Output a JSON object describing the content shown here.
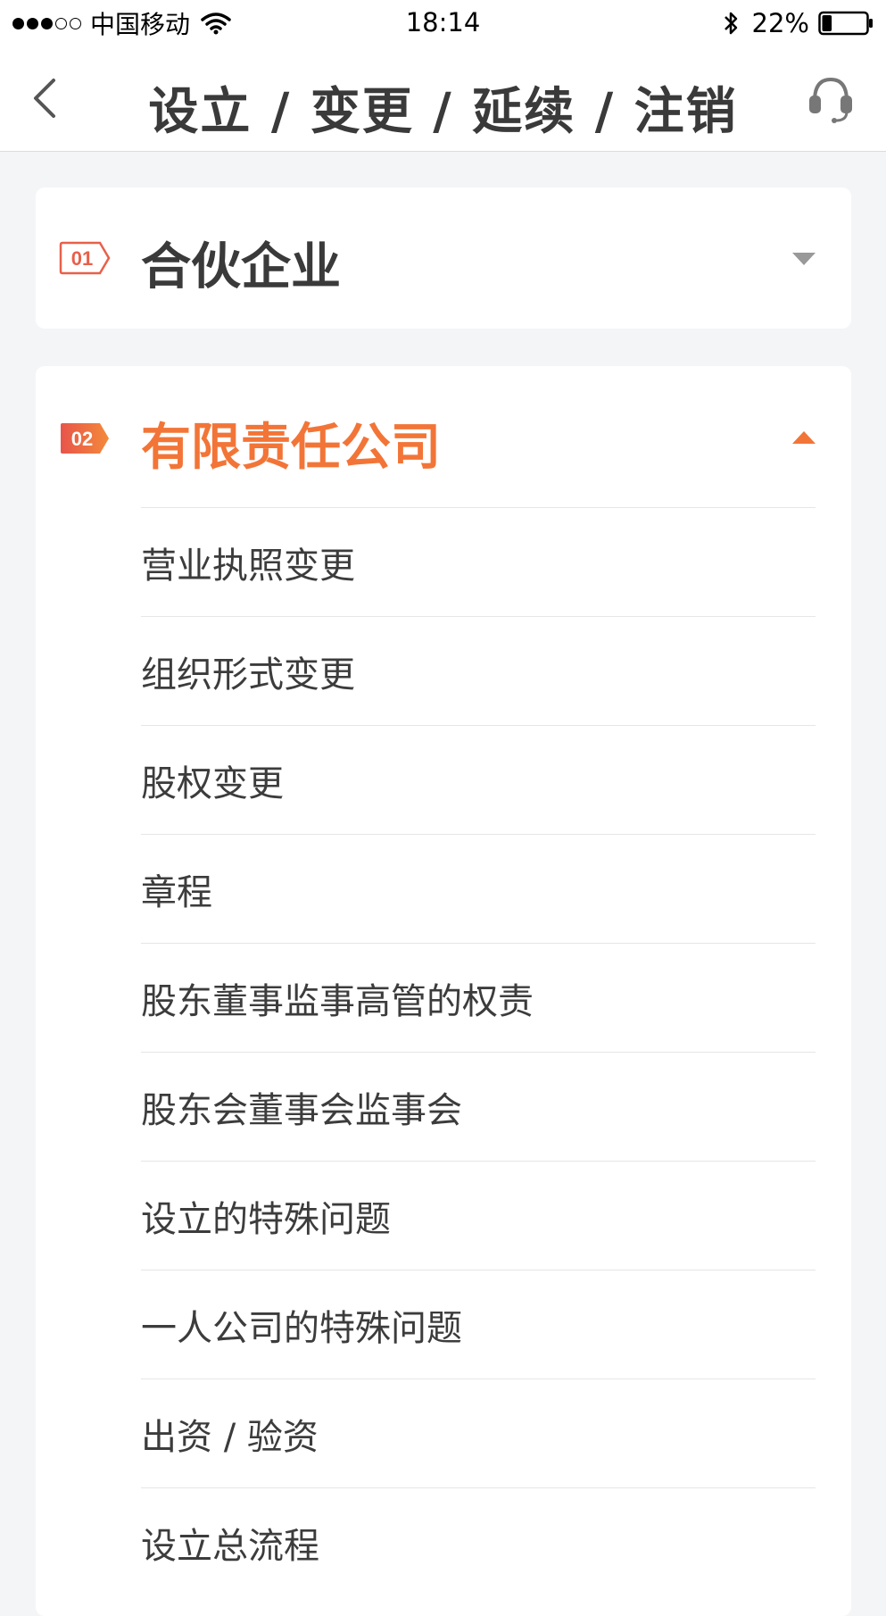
{
  "status_bar": {
    "carrier": "中国移动",
    "time": "18:14",
    "battery": "22%",
    "battery_level": 0.22
  },
  "nav": {
    "title": "设立 / 变更 / 延续 / 注销"
  },
  "sections": [
    {
      "badge": "01",
      "title": "合伙企业",
      "expanded": false
    },
    {
      "badge": "02",
      "title": "有限责任公司",
      "expanded": true,
      "items": [
        "营业执照变更",
        "组织形式变更",
        "股权变更",
        "章程",
        "股东董事监事高管的权责",
        "股东会董事会监事会",
        "设立的特殊问题",
        "一人公司的特殊问题",
        "出资 / 验资",
        "设立总流程"
      ]
    }
  ],
  "colors": {
    "accent": "#f27537",
    "title_dark": "#3a3a3a",
    "background": "#f3f5f7"
  },
  "icons": {
    "back": "chevron-left-icon",
    "support": "headset-icon",
    "collapsed": "caret-down-icon",
    "expanded": "caret-up-icon"
  }
}
